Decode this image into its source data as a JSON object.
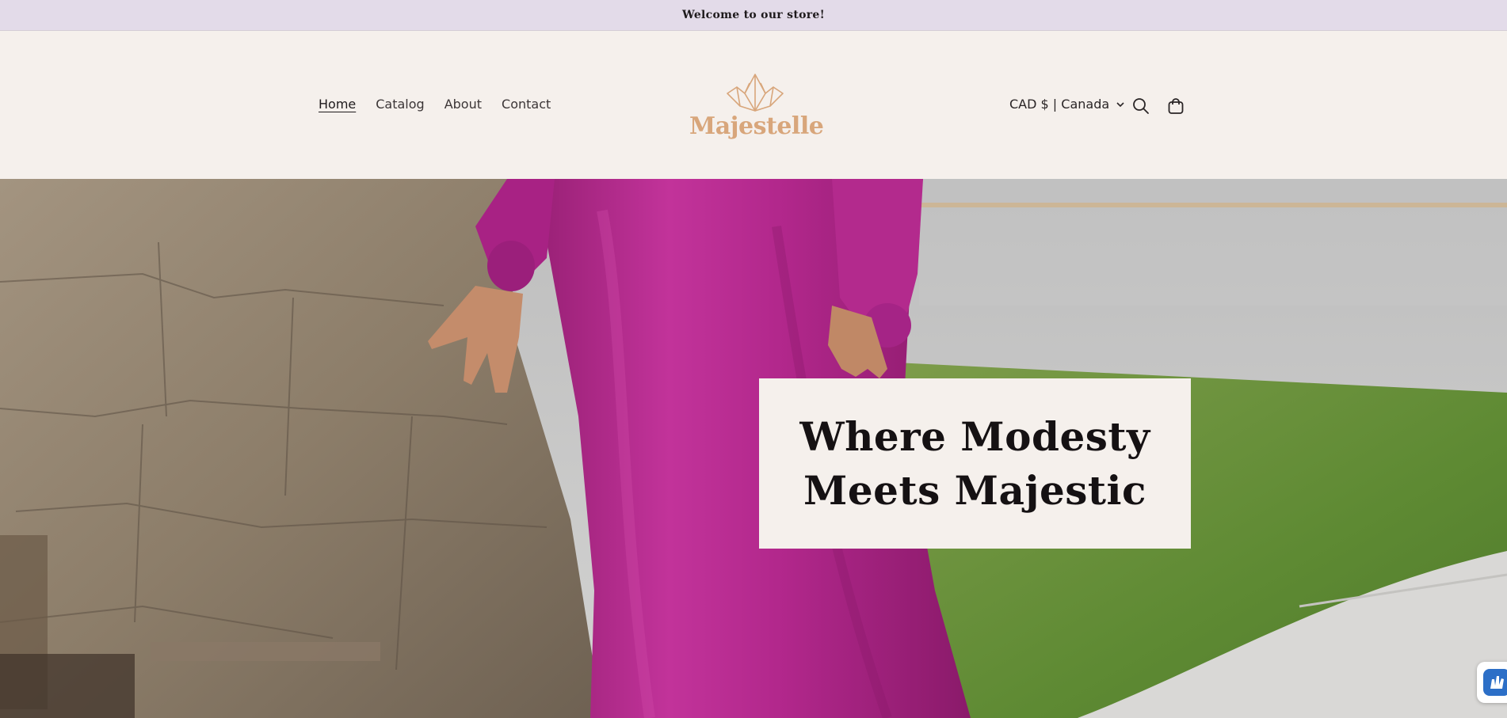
{
  "announcement": {
    "text": "Welcome to our store!"
  },
  "nav": {
    "items": [
      "Home",
      "Catalog",
      "About",
      "Contact"
    ],
    "active": "Home"
  },
  "brand": {
    "name": "Majestelle",
    "color": "#d8a67b"
  },
  "header": {
    "locale_label": "CAD $ | Canada",
    "search_icon": "search-icon",
    "cart_icon": "cart-icon"
  },
  "hero": {
    "title_line1": "Where Modesty",
    "title_line2": "Meets Majestic"
  },
  "colors": {
    "announcement_bg": "#e3dbe9",
    "header_bg": "#f5f0ec",
    "dress": "#b9288f"
  }
}
